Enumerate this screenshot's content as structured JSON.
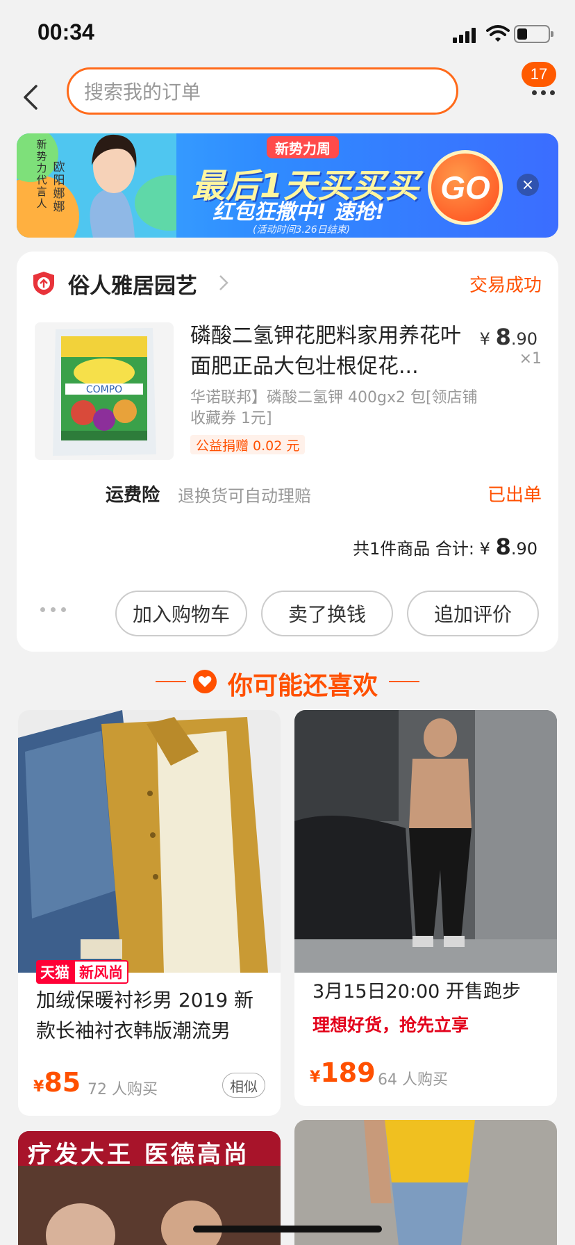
{
  "status_bar": {
    "time": "00:34"
  },
  "header": {
    "search_placeholder": "搜索我的订单",
    "message_count": "17"
  },
  "banner": {
    "vertical_text_1": "新势力代言人",
    "vertical_text_2": "欧阳娜娜",
    "tag": "新势力周",
    "headline": "最后1天买买买",
    "subline": "红包狂撒中! 速抢!",
    "note": "(活动时间3.26日结束)",
    "go_label": "GO",
    "close_icon": "×"
  },
  "order": {
    "shop_name": "俗人雅居园艺",
    "status": "交易成功",
    "product": {
      "title": "磷酸二氢钾花肥料家用养花叶面肥正品大包壮根促花...",
      "price_symbol": "¥",
      "price_int": "8",
      "price_dec": ".90",
      "quantity": "×1",
      "sku": "华诺联邦】磷酸二氢钾 400gx2 包[领店铺收藏券 1元]",
      "charity": "公益捐赠 0.02 元",
      "image_label": "COMPO"
    },
    "insurance": {
      "title": "运费险",
      "description": "退换货可自动理赔",
      "status": "已出单"
    },
    "total": {
      "label": "共1件商品  合计: ",
      "symbol": "¥ ",
      "amount_int": "8",
      "amount_dec": ".90"
    },
    "actions": [
      "加入购物车",
      "卖了换钱",
      "追加评价"
    ]
  },
  "recommendations": {
    "title": "你可能还喜欢",
    "items": [
      {
        "badge_a": "天猫",
        "badge_b": "新风尚",
        "title": "加绒保暖衬衫男 2019 新款长袖衬衣韩版潮流男",
        "currency": "¥",
        "price": "85",
        "sold": "72 人购买",
        "similar": "相似"
      },
      {
        "title": "3月15日20:00 开售跑步",
        "promo": "理想好货，抢先立享",
        "currency": "¥",
        "price": "189",
        "sold": "64 人购买"
      },
      {
        "banner_text": "疗发大王  医德高尚"
      }
    ]
  },
  "colors": {
    "accent": "#ff5000",
    "search_border": "#ff6a1a",
    "tmall_red": "#ff0036"
  }
}
